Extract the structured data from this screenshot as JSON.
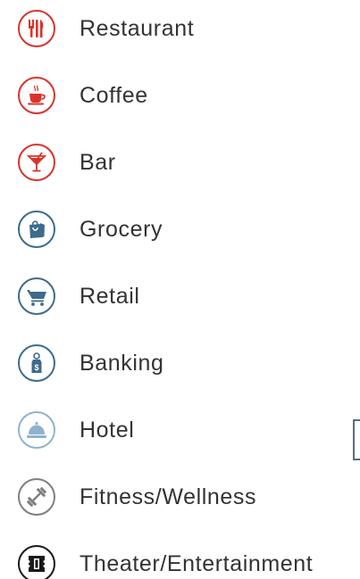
{
  "categories": [
    {
      "label": "Restaurant",
      "icon": "utensils-icon",
      "color": "#d9332b"
    },
    {
      "label": "Coffee",
      "icon": "coffee-cup-icon",
      "color": "#d9332b"
    },
    {
      "label": "Bar",
      "icon": "cocktail-glass-icon",
      "color": "#d9332b"
    },
    {
      "label": "Grocery",
      "icon": "shopping-bag-icon",
      "color": "#3d6b8c"
    },
    {
      "label": "Retail",
      "icon": "shopping-cart-icon",
      "color": "#3d6b8c"
    },
    {
      "label": "Banking",
      "icon": "money-tag-icon",
      "color": "#3d6b8c"
    },
    {
      "label": "Hotel",
      "icon": "service-bell-icon",
      "color": "#8fb3cc"
    },
    {
      "label": "Fitness/Wellness",
      "icon": "dumbbell-icon",
      "color": "#7f7f7f"
    },
    {
      "label": "Theater/Entertainment",
      "icon": "ticket-icon",
      "color": "#1a1a1a"
    }
  ]
}
